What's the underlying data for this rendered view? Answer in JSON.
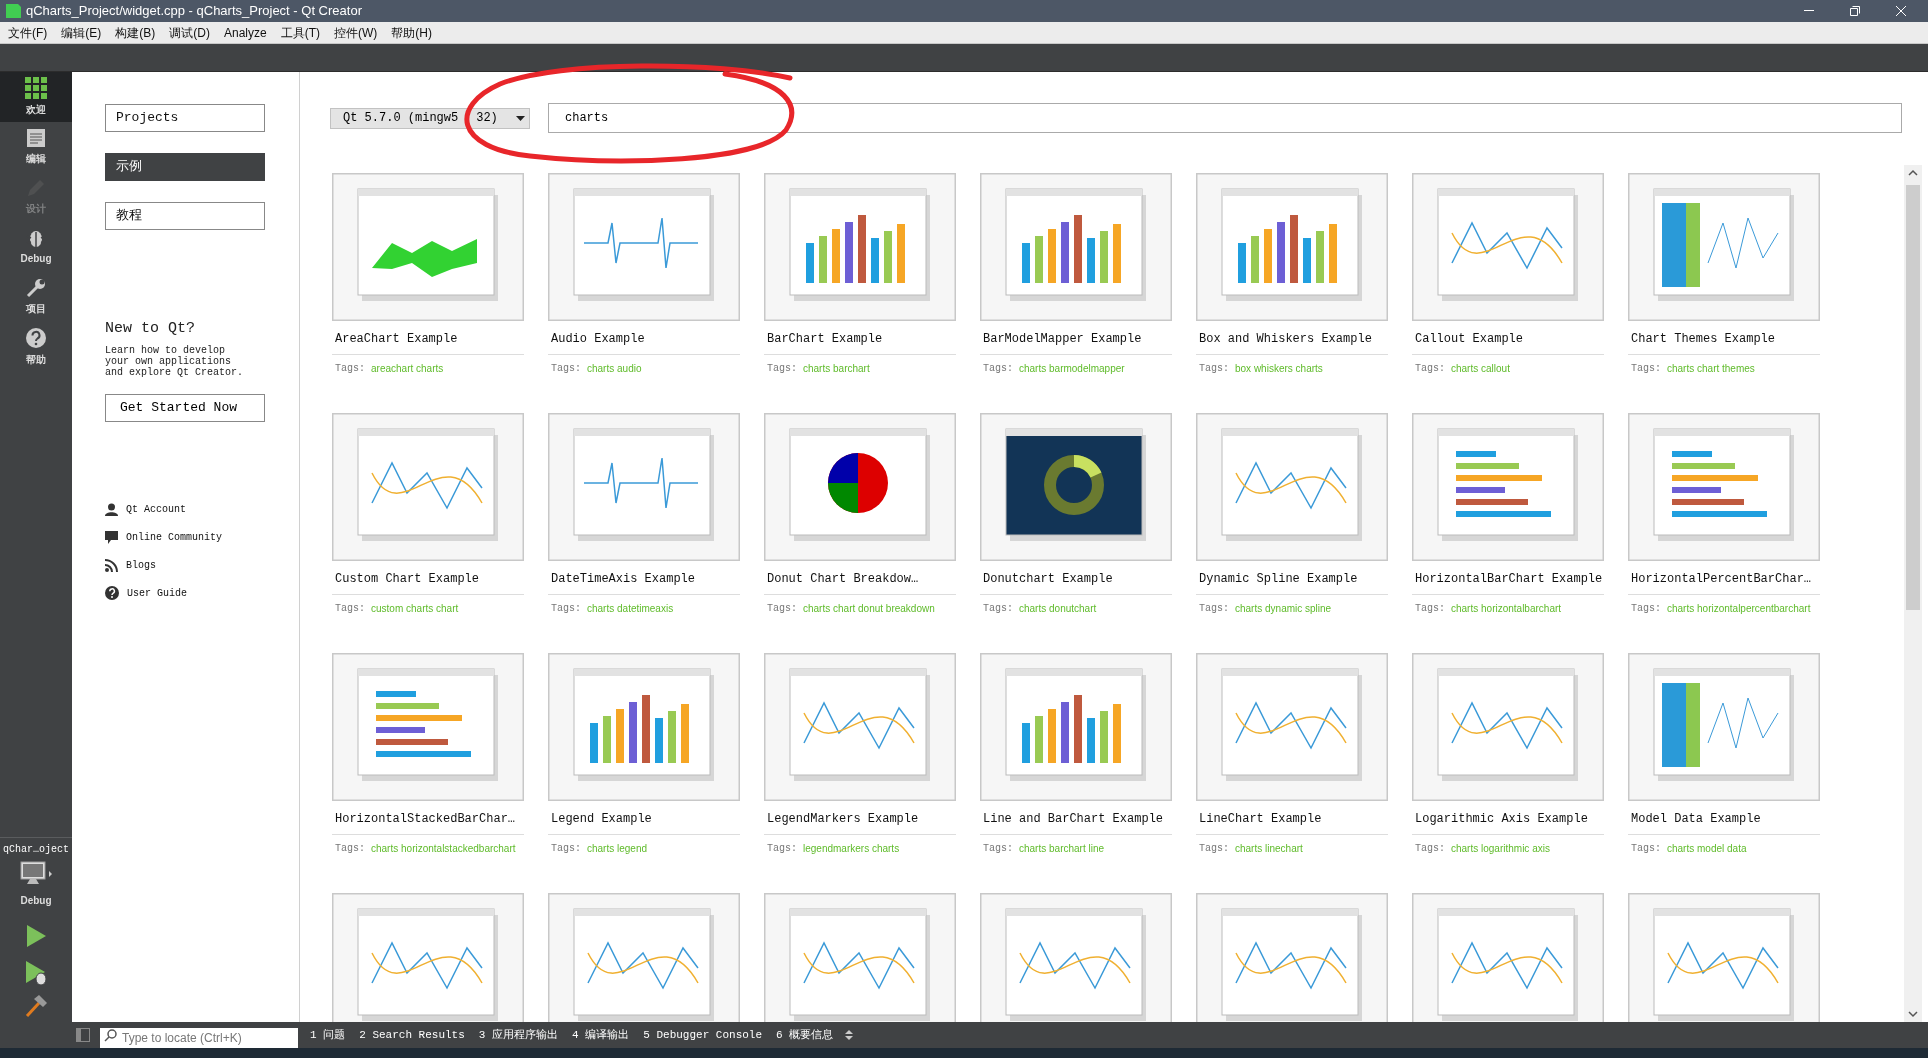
{
  "window": {
    "title": "qCharts_Project/widget.cpp - qCharts_Project - Qt Creator"
  },
  "menu": [
    "文件(F)",
    "编辑(E)",
    "构建(B)",
    "调试(D)",
    "Analyze",
    "工具(T)",
    "控件(W)",
    "帮助(H)"
  ],
  "mode_bar": {
    "items": [
      {
        "label": "欢迎",
        "kind": "welcome",
        "selected": true,
        "disabled": false
      },
      {
        "label": "编辑",
        "kind": "edit",
        "selected": false,
        "disabled": false
      },
      {
        "label": "设计",
        "kind": "design",
        "selected": false,
        "disabled": true
      },
      {
        "label": "Debug",
        "kind": "debug",
        "selected": false,
        "disabled": false
      },
      {
        "label": "项目",
        "kind": "projects",
        "selected": false,
        "disabled": false
      },
      {
        "label": "帮助",
        "kind": "help",
        "selected": false,
        "disabled": false
      }
    ],
    "target": {
      "project": "qChar…oject",
      "config": "Debug"
    }
  },
  "welcome": {
    "buttons": [
      {
        "label": "Projects",
        "selected": false
      },
      {
        "label": "示例",
        "selected": true
      },
      {
        "label": "教程",
        "selected": false
      }
    ],
    "heading": "New to Qt?",
    "text": "Learn how to develop your own applications and explore Qt Creator.",
    "button": "Get Started Now",
    "links": [
      {
        "label": "Qt Account",
        "kind": "account"
      },
      {
        "label": "Online Community",
        "kind": "community"
      },
      {
        "label": "Blogs",
        "kind": "blogs"
      },
      {
        "label": "User Guide",
        "kind": "guide"
      }
    ]
  },
  "examples": {
    "qt_version": [
      "Qt 5.7.0 (mingw5",
      "32)"
    ],
    "search": {
      "value": "charts"
    },
    "cards": [
      {
        "title": "AreaChart Example",
        "tags_label": "Tags:",
        "tags": "areachart charts"
      },
      {
        "title": "Audio Example",
        "tags_label": "Tags:",
        "tags": "charts audio"
      },
      {
        "title": "BarChart Example",
        "tags_label": "Tags:",
        "tags": "charts barchart"
      },
      {
        "title": "BarModelMapper Example",
        "tags_label": "Tags:",
        "tags": "charts barmodelmapper"
      },
      {
        "title": "Box and Whiskers Example",
        "tags_label": "Tags:",
        "tags": "box whiskers charts"
      },
      {
        "title": "Callout Example",
        "tags_label": "Tags:",
        "tags": "charts callout"
      },
      {
        "title": "Chart Themes Example",
        "tags_label": "Tags:",
        "tags": "charts chart themes"
      },
      {
        "title": "Custom Chart Example",
        "tags_label": "Tags:",
        "tags": "custom charts chart"
      },
      {
        "title": "DateTimeAxis Example",
        "tags_label": "Tags:",
        "tags": "charts datetimeaxis"
      },
      {
        "title": "Donut Chart Breakdow…",
        "tags_label": "Tags:",
        "tags": "charts chart donut breakdown"
      },
      {
        "title": "Donutchart Example",
        "tags_label": "Tags:",
        "tags": "charts donutchart"
      },
      {
        "title": "Dynamic Spline Example",
        "tags_label": "Tags:",
        "tags": "charts dynamic spline"
      },
      {
        "title": "HorizontalBarChart Example",
        "tags_label": "Tags:",
        "tags": "charts horizontalbarchart"
      },
      {
        "title": "HorizontalPercentBarChar…",
        "tags_label": "Tags:",
        "tags": "charts horizontalpercentbarchart"
      },
      {
        "title": "HorizontalStackedBarChar…",
        "tags_label": "Tags:",
        "tags": "charts horizontalstackedbarchart"
      },
      {
        "title": "Legend Example",
        "tags_label": "Tags:",
        "tags": "charts legend"
      },
      {
        "title": "LegendMarkers Example",
        "tags_label": "Tags:",
        "tags": "legendmarkers charts"
      },
      {
        "title": "Line and BarChart Example",
        "tags_label": "Tags:",
        "tags": "charts barchart line"
      },
      {
        "title": "LineChart Example",
        "tags_label": "Tags:",
        "tags": "charts linechart"
      },
      {
        "title": "Logarithmic Axis Example",
        "tags_label": "Tags:",
        "tags": "charts logarithmic axis"
      },
      {
        "title": "Model Data Example",
        "tags_label": "Tags:",
        "tags": "charts model data"
      }
    ],
    "partial_row": [
      {
        "kind": "picture"
      },
      {
        "kind": "picture"
      },
      {
        "kind": "picture"
      },
      {
        "kind": "picture"
      },
      {
        "kind": "picture"
      },
      {
        "kind": "picture"
      },
      {
        "kind": "picture"
      }
    ]
  },
  "status_bar": {
    "locate_placeholder": "Type to locate (Ctrl+K)",
    "panes": [
      "1 问题",
      "2 Search Results",
      "3 应用程序输出",
      "4 编译输出",
      "5 Debugger Console",
      "6 概要信息"
    ]
  }
}
